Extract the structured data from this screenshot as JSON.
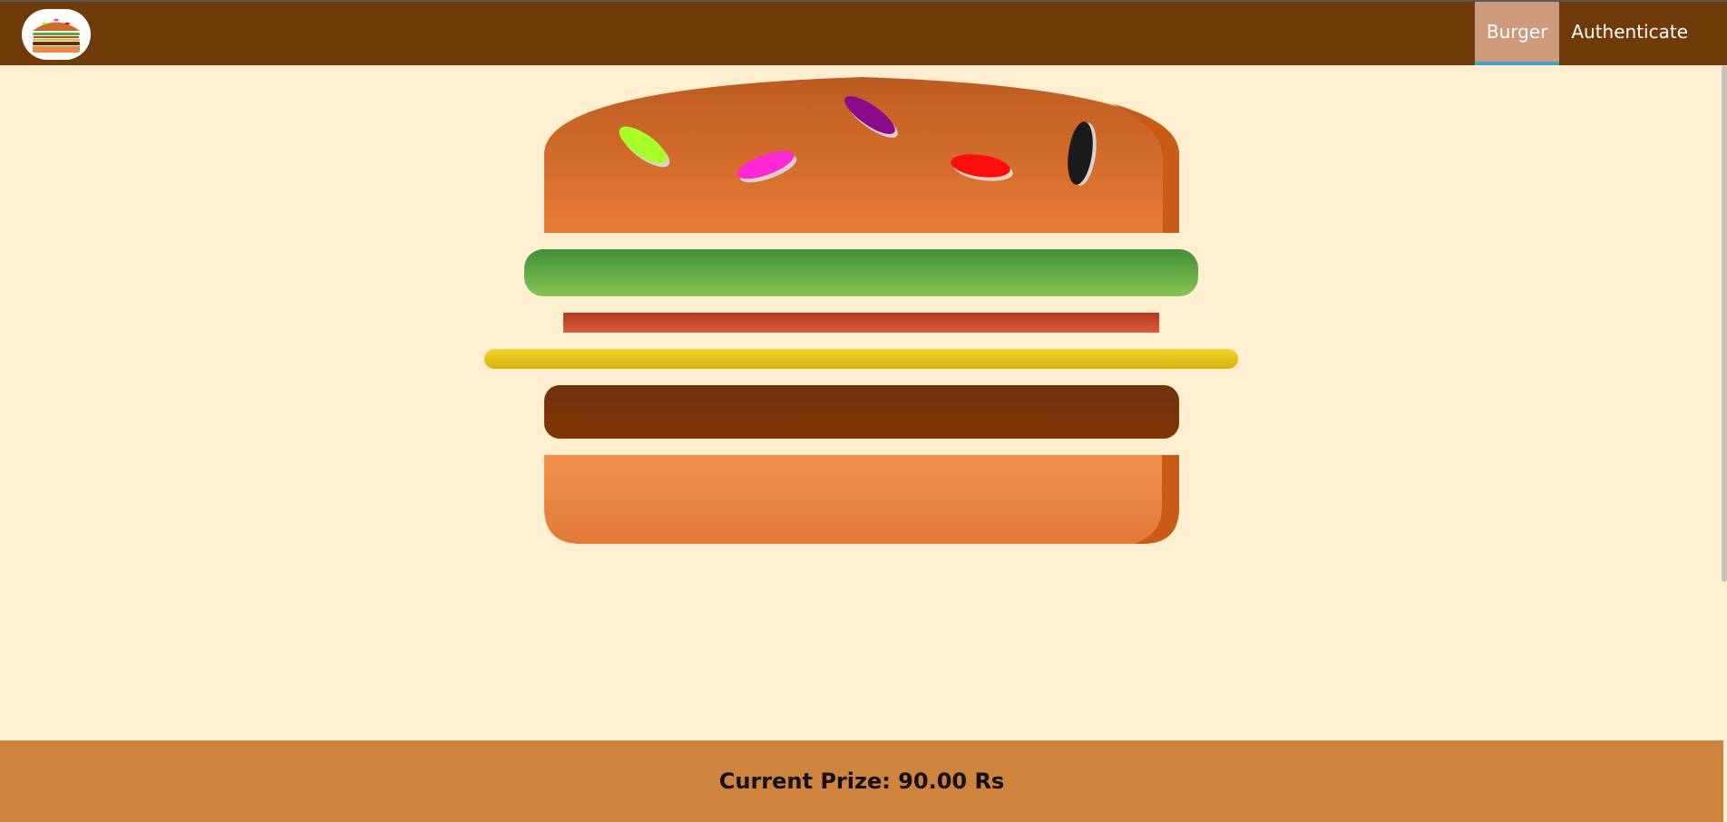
{
  "nav": {
    "items": [
      {
        "label": "Burger",
        "active": true
      },
      {
        "label": "Authenticate",
        "active": false
      }
    ]
  },
  "burger": {
    "layers": [
      "bread-top",
      "salad",
      "bacon",
      "cheese",
      "meat",
      "bread-bottom"
    ],
    "seed_colors": [
      "#a6ff26",
      "#ff26d6",
      "#8a0a8a",
      "#ff0d0d",
      "#1a1a1a"
    ]
  },
  "footer": {
    "prize_text": "Current Prize: 90.00 Rs"
  },
  "colors": {
    "topbar": "#703b09",
    "page_background": "#ffeecf",
    "footer": "#cf843d",
    "active_tab": "#cf9a7b",
    "active_tab_underline": "#40a4c8"
  }
}
